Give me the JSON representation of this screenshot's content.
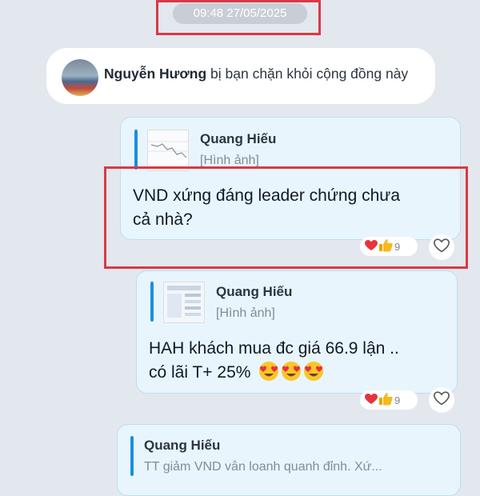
{
  "timestamp": "09:48 27/05/2025",
  "notice": {
    "name": "Nguyễn Hương",
    "text": " bị bạn chặn khỏi cộng đồng này"
  },
  "messages": [
    {
      "quote_name": "Quang Hiếu",
      "quote_text": "[Hình ảnh]",
      "text_line1": "VND xứng đáng leader chứng chưa",
      "text_line2": "cả nhà?",
      "reaction_count": "9",
      "reaction_icons": [
        "heart-icon",
        "thumbs-up-icon"
      ]
    },
    {
      "quote_name": "Quang Hiếu",
      "quote_text": "[Hình ảnh]",
      "text_line1": "HAH khách mua đc giá 66.9 lận ..",
      "text_line2": "có lãi T+ 25%",
      "reaction_count": "9",
      "reaction_icons": [
        "heart-icon",
        "thumbs-up-icon"
      ]
    },
    {
      "quote_name": "Quang Hiếu",
      "quote_text": "TT giảm VND vẫn loanh quanh đỉnh. Xứ..."
    }
  ],
  "colors": {
    "highlight": "#d83a45",
    "bubble": "#e8f5fc",
    "quote_bar": "#1a8fe3",
    "background": "#e3e7ee"
  }
}
